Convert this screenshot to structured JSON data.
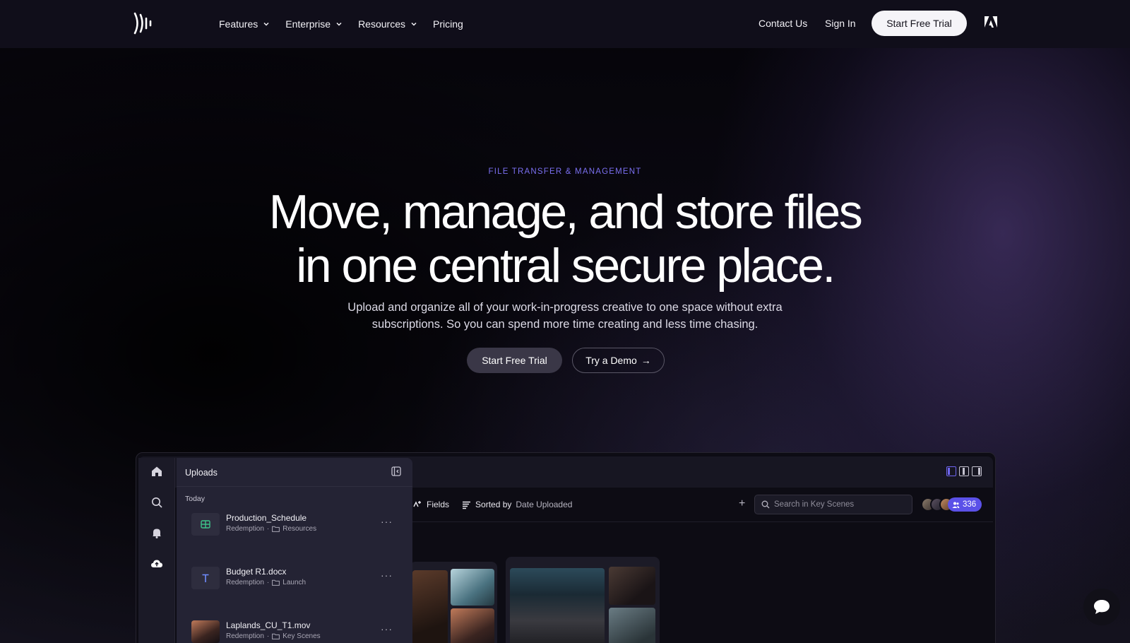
{
  "nav": {
    "items": [
      {
        "label": "Features",
        "has_dropdown": true
      },
      {
        "label": "Enterprise",
        "has_dropdown": true
      },
      {
        "label": "Resources",
        "has_dropdown": true
      },
      {
        "label": "Pricing",
        "has_dropdown": false
      }
    ],
    "contact_label": "Contact Us",
    "signin_label": "Sign In",
    "cta_label": "Start Free Trial"
  },
  "hero": {
    "eyebrow": "FILE TRANSFER & MANAGEMENT",
    "headline_line1": "Move, manage, and store files",
    "headline_line2": "in one central secure place.",
    "subtext_line1": "Upload and organize all of your work-in-progress creative to one space without extra",
    "subtext_line2": "subscriptions. So you can spend more time creating and less time chasing.",
    "primary_cta": "Start Free Trial",
    "secondary_cta": "Try a Demo",
    "secondary_arrow": "→"
  },
  "app": {
    "toolbar": {
      "fields_label": "Fields",
      "sorted_by_label": "Sorted by",
      "sorted_by_value": "Date Uploaded"
    },
    "search": {
      "placeholder": "Search in Key Scenes"
    },
    "member_count": "336",
    "uploads_panel": {
      "title": "Uploads",
      "group_label": "Today",
      "files": [
        {
          "name": "Production_Schedule",
          "project": "Redemption",
          "folder": "Resources",
          "type": "sheet"
        },
        {
          "name": "Budget R1.docx",
          "project": "Redemption",
          "folder": "Launch",
          "type": "doc"
        },
        {
          "name": "Laplands_CU_T1.mov",
          "project": "Redemption",
          "folder": "Key Scenes",
          "type": "video"
        }
      ],
      "more_label": "···"
    }
  },
  "colors": {
    "accent": "#5b51e8",
    "eyebrow": "#7a6ff0",
    "nav_bg": "#100e1a",
    "sheet_icon": "#3ec48a",
    "doc_icon": "#6f8cff"
  }
}
